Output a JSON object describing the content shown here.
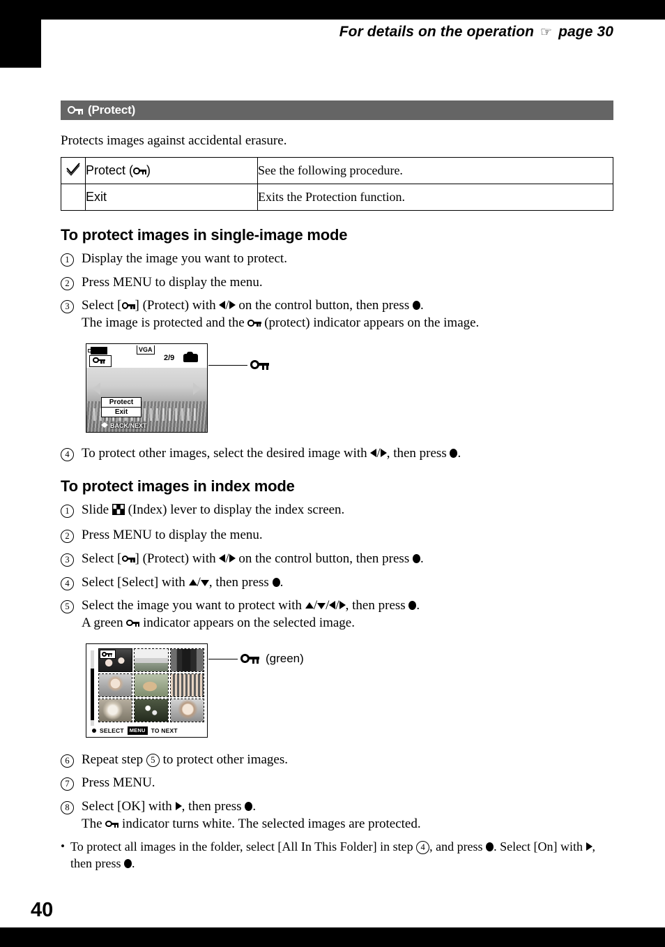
{
  "header": {
    "text_before": "For details on the operation",
    "hand_icon": "pointing-hand-icon",
    "text_after": "page 30"
  },
  "page_number": "40",
  "banner": {
    "key_icon": "key-icon",
    "label": "(Protect)"
  },
  "intro": "Protects images against accidental erasure.",
  "options_table": {
    "rows": [
      {
        "check": "✓",
        "name_prefix": "Protect (",
        "name_suffix": ")",
        "name_icon": "key-icon",
        "desc": "See the following procedure."
      },
      {
        "check": "",
        "name_prefix": "Exit",
        "name_suffix": "",
        "name_icon": "",
        "desc": "Exits the Protection function."
      }
    ]
  },
  "section1": {
    "heading": "To protect images in single-image mode",
    "steps": [
      {
        "num": "1",
        "text": "Display the image you want to protect."
      },
      {
        "num": "2",
        "text": "Press MENU to display the menu."
      },
      {
        "num": "3",
        "line1_a": "Select [",
        "line1_b": "] (Protect) with ",
        "line1_c": " on the control button, then press ",
        "line1_d": ".",
        "line2_a": "The image is protected and the ",
        "line2_b": " (protect) indicator appears on the image."
      },
      {
        "num": "4",
        "text_a": "To protect other images, select the desired image with ",
        "text_b": ", then press ",
        "text_c": "."
      }
    ]
  },
  "figure_single": {
    "battery_icon": "battery-icon",
    "quality": "VGA",
    "counter": "2/9",
    "folder_icon": "camera-folder-icon",
    "key_badge_icon": "key-icon",
    "menu_items": [
      "Protect",
      "Exit"
    ],
    "hint": "BACK/NEXT",
    "callout_label": "",
    "callout_icon": "key-icon"
  },
  "section2": {
    "heading": "To protect images in index mode",
    "steps": [
      {
        "num": "1",
        "text_a": "Slide ",
        "text_b": " (Index) lever to display the index screen.",
        "icon": "index-grid-icon"
      },
      {
        "num": "2",
        "text": "Press MENU to display the menu."
      },
      {
        "num": "3",
        "line1_a": "Select [",
        "line1_b": "] (Protect) with ",
        "line1_c": " on the control button, then press ",
        "line1_d": "."
      },
      {
        "num": "4",
        "text_a": "Select [Select] with ",
        "text_b": ", then press ",
        "text_c": "."
      },
      {
        "num": "5",
        "line1_a": "Select the image you want to protect with ",
        "line1_b": ", then press ",
        "line1_c": ".",
        "line2_a": "A green ",
        "line2_b": " indicator appears on the selected image."
      },
      {
        "num": "6",
        "text_a": "Repeat step ",
        "text_b": " to protect other images.",
        "ref": "5"
      },
      {
        "num": "7",
        "text": "Press MENU."
      },
      {
        "num": "8",
        "line1_a": "Select [OK] with ",
        "line1_b": ", then press ",
        "line1_c": ".",
        "line2_a": "The ",
        "line2_b": " indicator turns white. The selected images are protected."
      }
    ],
    "note": {
      "a": "To protect all images in the folder, select [All In This Folder] in step ",
      "ref": "4",
      "b": ", and press ",
      "c": ". Select [On] with ",
      "d": ", ",
      "e": "then press ",
      "f": "."
    }
  },
  "figure_index": {
    "key_badge_icon": "key-icon",
    "select_label": "SELECT",
    "menu_tag": "MENU",
    "to_next_label": "TO NEXT",
    "callout_label": "(green)",
    "callout_icon": "key-icon",
    "cells": [
      {
        "selected": true,
        "alt": "two-people-photo"
      },
      {
        "selected": false,
        "alt": "landscape-photo"
      },
      {
        "selected": false,
        "alt": "arch-monument-photo"
      },
      {
        "selected": false,
        "alt": "woman-portrait-photo"
      },
      {
        "selected": false,
        "alt": "dog-photo"
      },
      {
        "selected": false,
        "alt": "group-people-photo"
      },
      {
        "selected": false,
        "alt": "rose-photo"
      },
      {
        "selected": false,
        "alt": "flowers-photo"
      },
      {
        "selected": false,
        "alt": "smiling-woman-photo"
      }
    ]
  },
  "colors": {
    "banner_gray": "#656565",
    "page_black": "#000000",
    "paper": "#ffffff"
  }
}
